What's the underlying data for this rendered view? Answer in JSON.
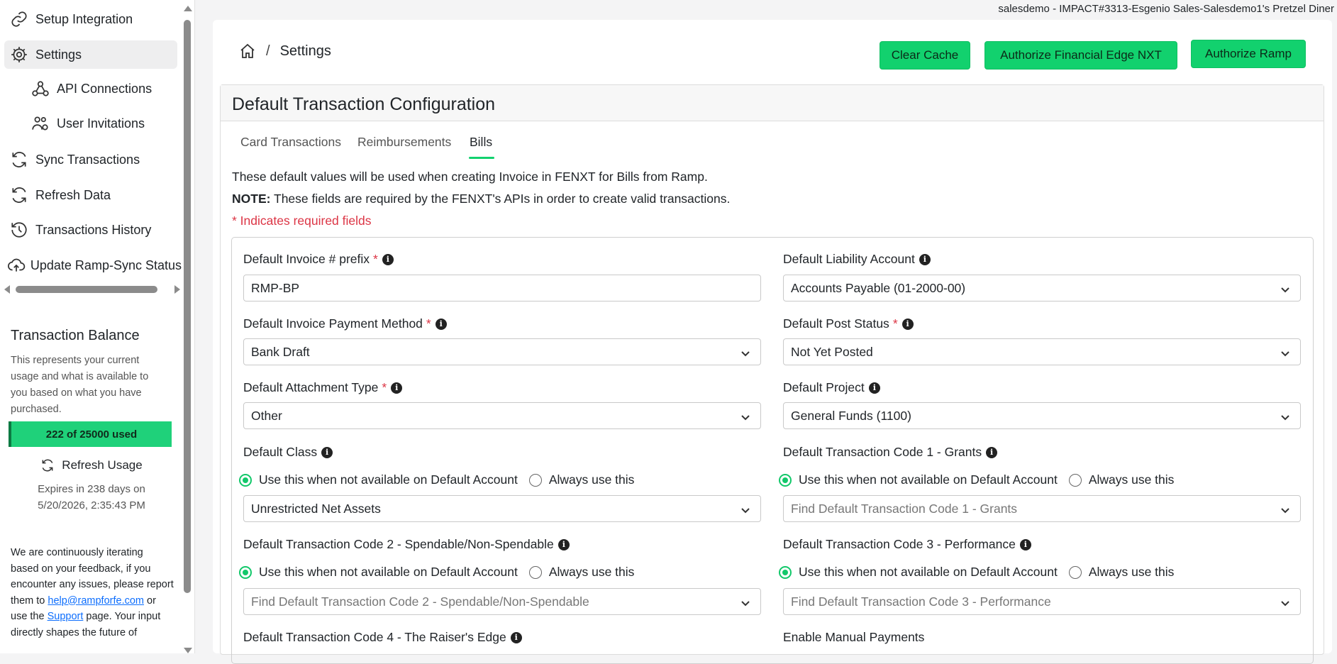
{
  "sidebar": {
    "items": [
      {
        "label": "Setup Integration",
        "icon": "link-icon"
      },
      {
        "label": "Settings",
        "icon": "gear-icon"
      },
      {
        "label": "API Connections",
        "icon": "webhook-icon"
      },
      {
        "label": "User Invitations",
        "icon": "users-gear-icon"
      },
      {
        "label": "Sync Transactions",
        "icon": "sync-icon"
      },
      {
        "label": "Refresh Data",
        "icon": "refresh-icon"
      },
      {
        "label": "Transactions History",
        "icon": "history-icon"
      },
      {
        "label": "Update Ramp-Sync Status",
        "icon": "cloud-upload-icon"
      }
    ],
    "balance": {
      "title": "Transaction Balance",
      "description": "This represents your current usage and what is available to you based on what you have purchased.",
      "usage": "222 of 25000 used",
      "usage_fraction": 0.00888,
      "refresh_label": "Refresh Usage",
      "expires_line1": "Expires in 238 days on",
      "expires_line2": "5/20/2026, 2:35:43 PM"
    },
    "feedback": {
      "text_before": "We are continuously iterating based on your feedback, if you encounter any issues, please report them to ",
      "email": "help@rampforfe.com",
      "text_middle": " or use the ",
      "support_link": "Support",
      "text_after": " page. Your input directly shapes the future of"
    }
  },
  "tenant": "salesdemo - IMPACT#3313-Esgenio Sales-Salesdemo1's Pretzel Diner",
  "breadcrumb": {
    "separator": "/",
    "current": "Settings"
  },
  "buttons": {
    "clear_cache": "Clear Cache",
    "authorize_fe": "Authorize Financial Edge NXT",
    "authorize_ramp": "Authorize Ramp"
  },
  "section": {
    "title": "Default Transaction Configuration",
    "tabs": [
      "Card Transactions",
      "Reimbursements",
      "Bills"
    ],
    "active_tab": "Bills",
    "info": "These default values will be used when creating Invoice in FENXT for Bills from Ramp.",
    "note_label": "NOTE:",
    "note_text": " These fields are required by the FENXT's APIs in order to create valid transactions.",
    "required_hint": "* Indicates required fields"
  },
  "form": {
    "invoice_prefix": {
      "label": "Default Invoice # prefix",
      "value": "RMP-BP"
    },
    "liability_account": {
      "label": "Default Liability Account",
      "value": "Accounts Payable (01-2000-00)"
    },
    "payment_method": {
      "label": "Default Invoice Payment Method",
      "value": "Bank Draft"
    },
    "post_status": {
      "label": "Default Post Status",
      "value": "Not Yet Posted"
    },
    "attachment_type": {
      "label": "Default Attachment Type",
      "value": "Other"
    },
    "project": {
      "label": "Default Project",
      "value": "General Funds (1100)"
    },
    "class": {
      "label": "Default Class",
      "value": "Unrestricted Net Assets"
    },
    "tc1": {
      "label": "Default Transaction Code 1 - Grants",
      "placeholder": "Find Default Transaction Code 1 - Grants"
    },
    "tc2": {
      "label": "Default Transaction Code 2 - Spendable/Non-Spendable",
      "placeholder": "Find Default Transaction Code 2 - Spendable/Non-Spendable"
    },
    "tc3": {
      "label": "Default Transaction Code 3 - Performance",
      "placeholder": "Find Default Transaction Code 3 - Performance"
    },
    "tc4": {
      "label": "Default Transaction Code 4 - The Raiser's Edge"
    },
    "manual_payments": {
      "label": "Enable Manual Payments"
    },
    "radio_when_not_available": "Use this when not available on Default Account",
    "radio_always": "Always use this",
    "required_star": "*"
  },
  "colors": {
    "accent": "#12d16e",
    "required": "#dc3545",
    "link": "#0d6efd"
  }
}
